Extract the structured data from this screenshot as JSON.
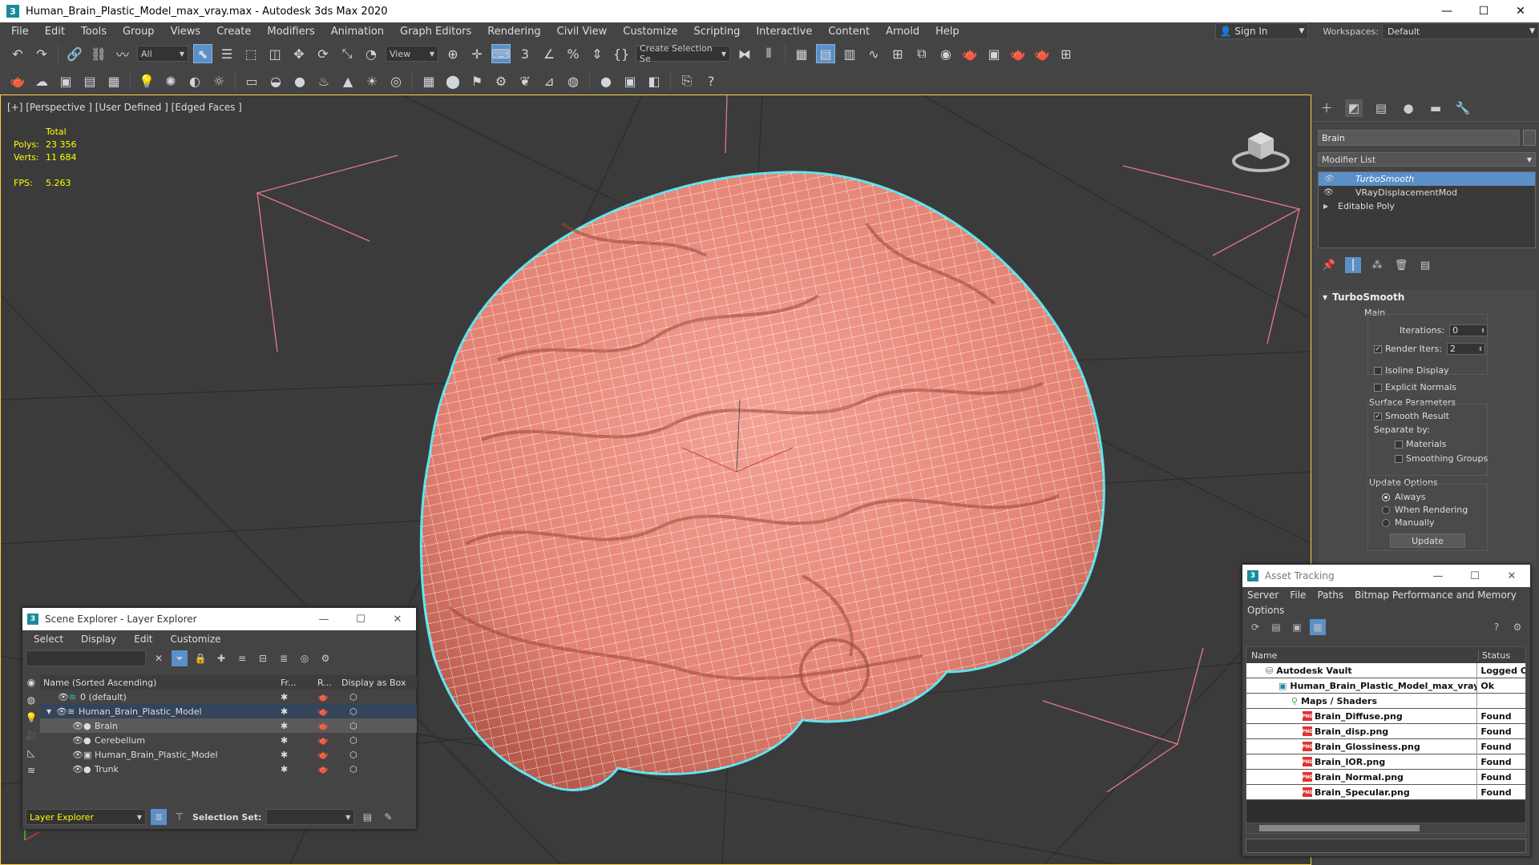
{
  "title": "Human_Brain_Plastic_Model_max_vray.max - Autodesk 3ds Max 2020",
  "menu": [
    "File",
    "Edit",
    "Tools",
    "Group",
    "Views",
    "Create",
    "Modifiers",
    "Animation",
    "Graph Editors",
    "Rendering",
    "Civil View",
    "Customize",
    "Scripting",
    "Interactive",
    "Content",
    "Arnold",
    "Help"
  ],
  "account": {
    "sign_in": "Sign In",
    "workspaces_label": "Workspaces:",
    "workspace": "Default"
  },
  "toolbar": {
    "filter": "All",
    "refcoord": "View",
    "selection_set": "Create Selection Se"
  },
  "viewport": {
    "label": "[+] [Perspective ] [User Defined ] [Edged Faces ]",
    "stats": {
      "total_label": "Total",
      "polys_label": "Polys:",
      "polys": "23 356",
      "verts_label": "Verts:",
      "verts": "11 684",
      "fps_label": "FPS:",
      "fps": "5.263"
    }
  },
  "command_panel": {
    "object_name": "Brain",
    "modifier_list": "Modifier List",
    "stack": [
      "TurboSmooth",
      "VRayDisplacementMod",
      "Editable Poly"
    ],
    "rollout": {
      "title": "TurboSmooth",
      "main": "Main",
      "iterations_label": "Iterations:",
      "iterations": "0",
      "render_iters_label": "Render Iters:",
      "render_iters": "2",
      "isoline": "Isoline Display",
      "explicit_normals": "Explicit Normals",
      "surface_params": "Surface Parameters",
      "smooth_result": "Smooth Result",
      "separate_by": "Separate by:",
      "materials": "Materials",
      "smoothing_groups": "Smoothing Groups",
      "update_options": "Update Options",
      "always": "Always",
      "when_rendering": "When Rendering",
      "manually": "Manually",
      "update": "Update"
    }
  },
  "scene_explorer": {
    "title": "Scene Explorer - Layer Explorer",
    "menu": [
      "Select",
      "Display",
      "Edit",
      "Customize"
    ],
    "columns": {
      "name": "Name (Sorted Ascending)",
      "frozen": "Fr...",
      "render": "R...",
      "box": "Display as Box"
    },
    "rows": [
      {
        "name": "0 (default)"
      },
      {
        "name": "Human_Brain_Plastic_Model"
      },
      {
        "name": "Brain"
      },
      {
        "name": "Cerebellum"
      },
      {
        "name": "Human_Brain_Plastic_Model"
      },
      {
        "name": "Trunk"
      }
    ],
    "footer": {
      "explorer": "Layer Explorer",
      "selection_set_label": "Selection Set:"
    }
  },
  "asset_tracking": {
    "title": "Asset Tracking",
    "menu": [
      "Server",
      "File",
      "Paths",
      "Bitmap Performance and Memory"
    ],
    "menu2": "Options",
    "columns": {
      "name": "Name",
      "status": "Status"
    },
    "rows": [
      {
        "name": "Autodesk Vault",
        "status": "Logged Or"
      },
      {
        "name": "Human_Brain_Plastic_Model_max_vray.max",
        "status": "Ok"
      },
      {
        "name": "Maps / Shaders",
        "status": ""
      },
      {
        "name": "Brain_Diffuse.png",
        "status": "Found"
      },
      {
        "name": "Brain_disp.png",
        "status": "Found"
      },
      {
        "name": "Brain_Glossiness.png",
        "status": "Found"
      },
      {
        "name": "Brain_IOR.png",
        "status": "Found"
      },
      {
        "name": "Brain_Normal.png",
        "status": "Found"
      },
      {
        "name": "Brain_Specular.png",
        "status": "Found"
      }
    ]
  },
  "colors": {
    "accent": "#5b8fc7",
    "brain": "#e9877a",
    "wire": "#fff",
    "selection_outline": "#5ce4ee",
    "stats": "#ffff00"
  }
}
